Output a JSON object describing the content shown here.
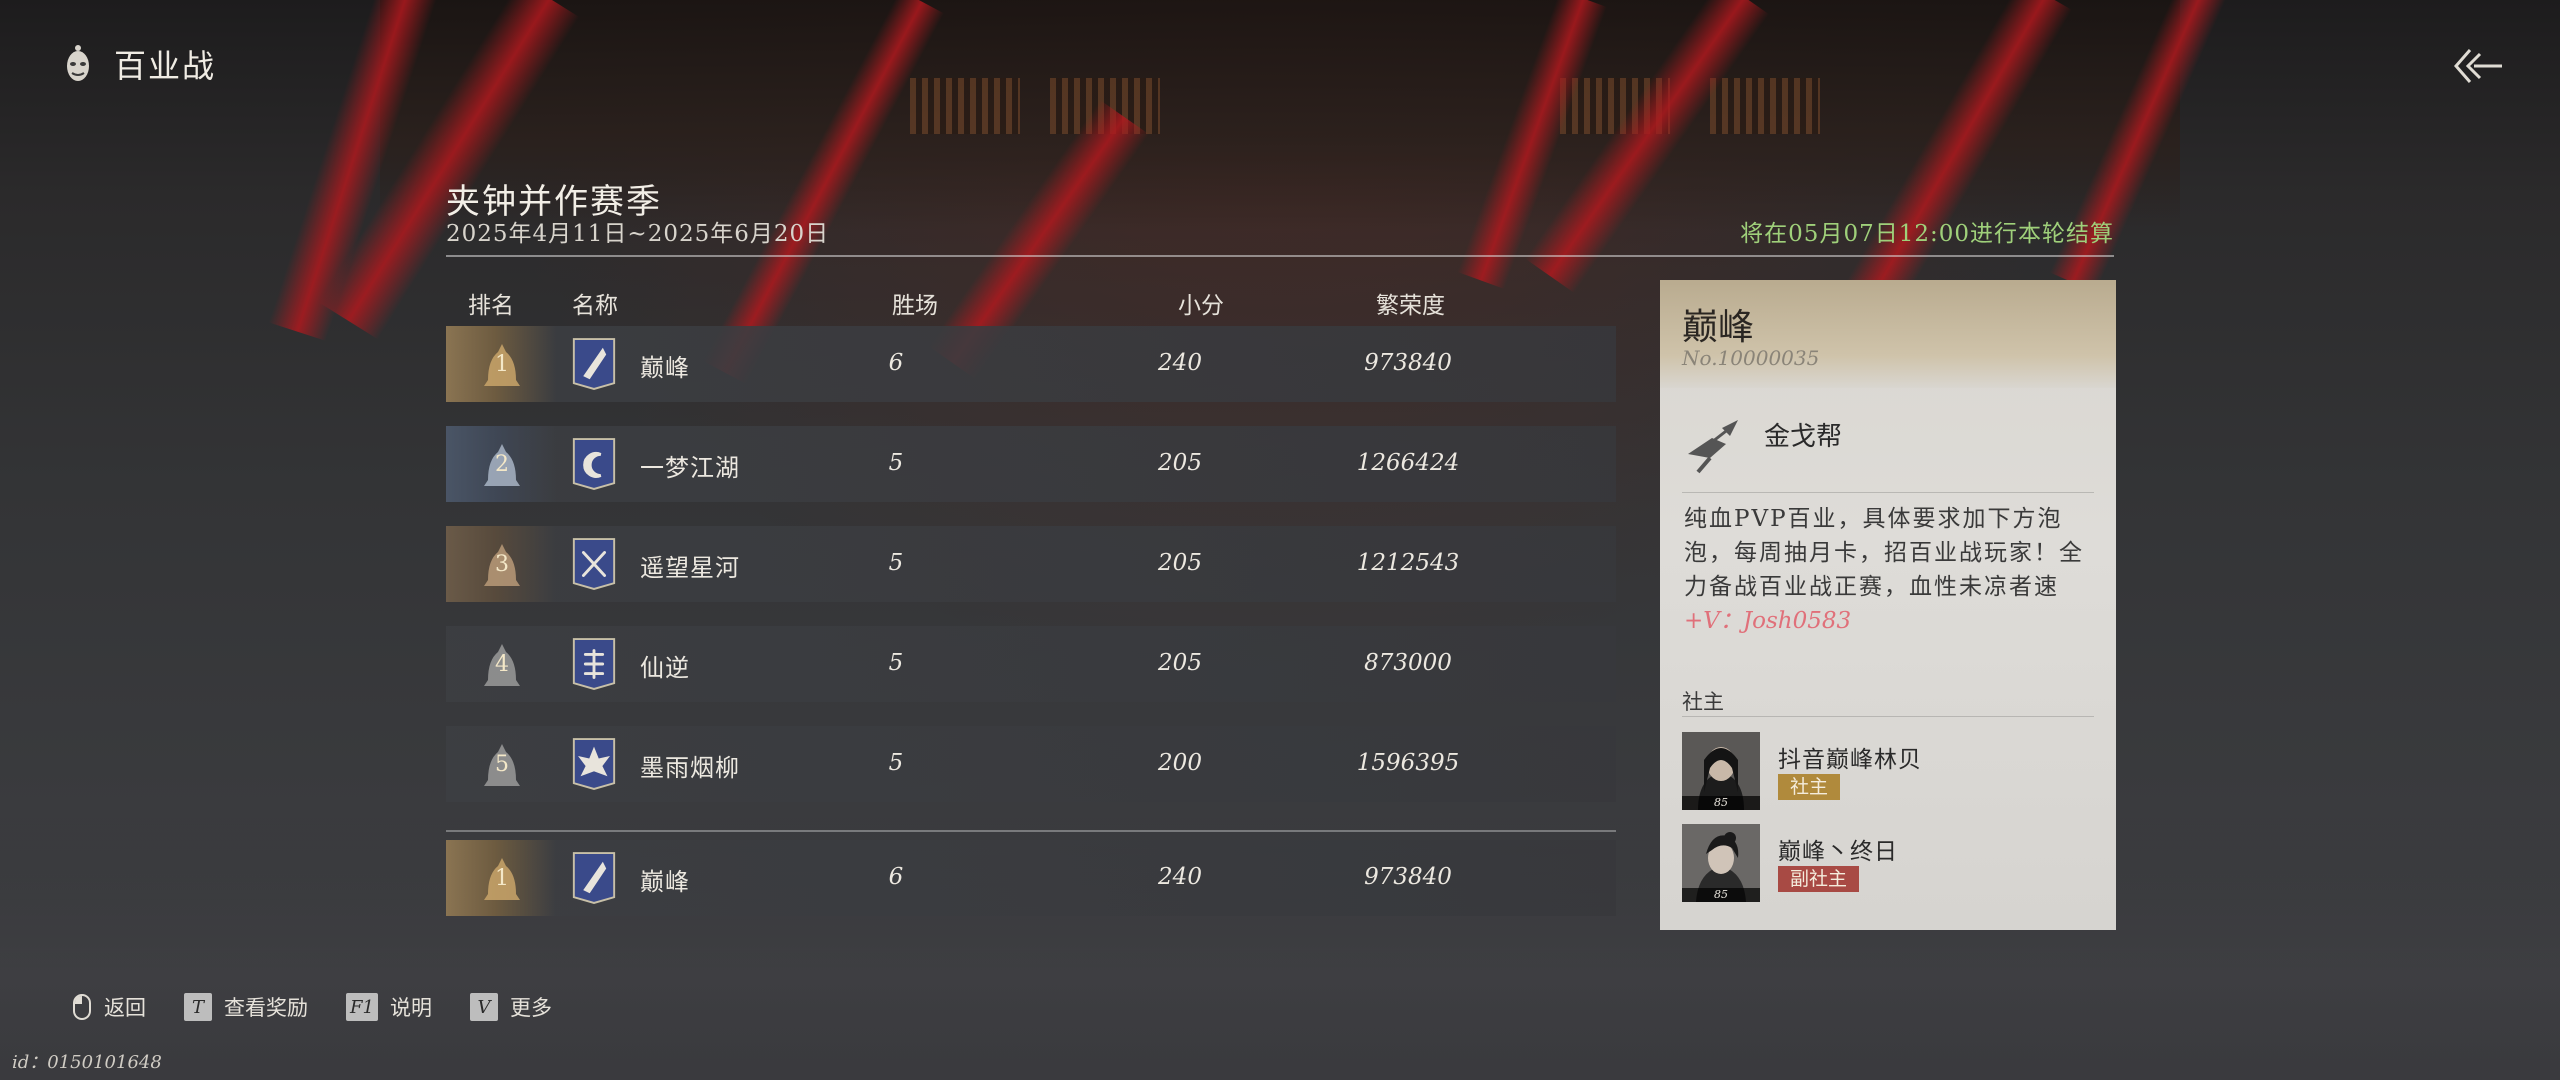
{
  "header": {
    "title": "百业战",
    "mode_icon": "mask-emblem-icon",
    "back_icon": "back-arrow-icon"
  },
  "season": {
    "title": "夹钟并作赛季",
    "dates": "2025年4月11日~2025年6月20日",
    "settlement": "将在05月07日12:00进行本轮结算"
  },
  "table": {
    "columns": [
      "排名",
      "名称",
      "胜场",
      "小分",
      "繁荣度"
    ],
    "rows": [
      {
        "rank": "1",
        "name": "巅峰",
        "wins": "6",
        "points": "240",
        "prosperity": "973840",
        "emblem": "quill-banner-icon"
      },
      {
        "rank": "2",
        "name": "一梦江湖",
        "wins": "5",
        "points": "205",
        "prosperity": "1266424",
        "emblem": "crescent-banner-icon"
      },
      {
        "rank": "3",
        "name": "遥望星河",
        "wins": "5",
        "points": "205",
        "prosperity": "1212543",
        "emblem": "crossed-swords-banner-icon"
      },
      {
        "rank": "4",
        "name": "仙逆",
        "wins": "5",
        "points": "205",
        "prosperity": "873000",
        "emblem": "sweet-char-banner-icon"
      },
      {
        "rank": "5",
        "name": "墨雨烟柳",
        "wins": "5",
        "points": "200",
        "prosperity": "1596395",
        "emblem": "maple-leaf-banner-icon"
      }
    ],
    "own": {
      "rank": "1",
      "name": "巅峰",
      "wins": "6",
      "points": "240",
      "prosperity": "973840",
      "emblem": "quill-banner-icon"
    }
  },
  "detail": {
    "name": "巅峰",
    "no": "No.10000035",
    "sect": "金戈帮",
    "sect_icon": "golden-spear-icon",
    "description": "纯血PVP百业，具体要求加下方泡泡，每周抽月卡，招百业战玩家！全力备战百业战正赛，血性未凉者速",
    "contact": "+V：Josh0583",
    "members_label": "社主",
    "members": [
      {
        "name": "抖音巅峰林贝",
        "role": "社主",
        "level": "85"
      },
      {
        "name": "巅峰丶终日",
        "role": "副社主",
        "level": "85"
      }
    ]
  },
  "footer": {
    "hints": [
      {
        "key": "",
        "label": "返回",
        "icon": "mouse-icon"
      },
      {
        "key": "T",
        "label": "查看奖励"
      },
      {
        "key": "F1",
        "label": "说明"
      },
      {
        "key": "V",
        "label": "更多"
      }
    ],
    "uid": "id：0150101648"
  },
  "colors": {
    "accent_green": "#9fd07a",
    "contact_red": "#e0707a",
    "role_gold": "#b08a3c",
    "role_red": "#a84a44"
  }
}
